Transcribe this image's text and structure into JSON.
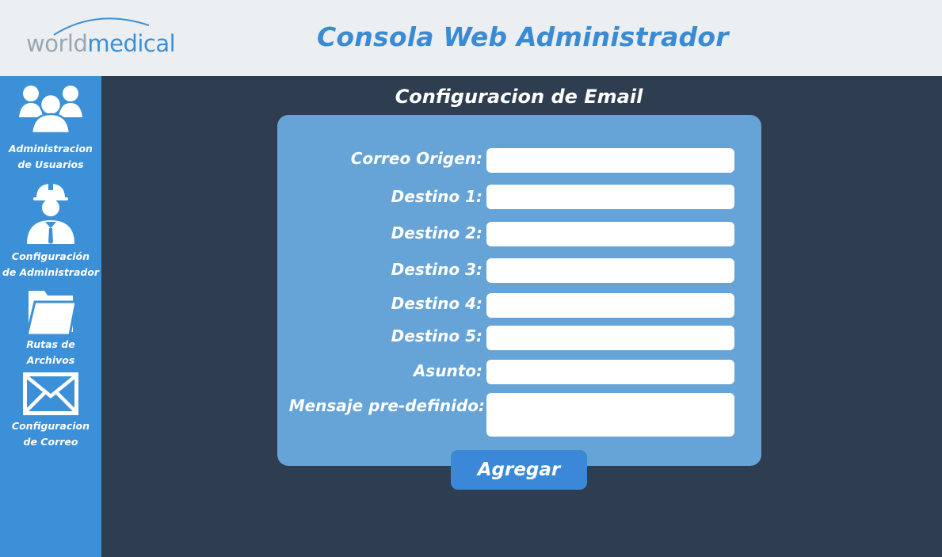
{
  "header": {
    "logo": {
      "part1": "world",
      "part2": "medical"
    },
    "title": "Consola Web Administrador"
  },
  "sidebar": {
    "items": [
      {
        "label": "Administracion\nde Usuarios",
        "icon": "users-icon"
      },
      {
        "label": "Configuración\nde Administrador",
        "icon": "administrator-icon"
      },
      {
        "label": "Rutas de\nArchivos",
        "icon": "folder-icon"
      },
      {
        "label": "Configuracion\nde Correo",
        "icon": "mail-icon"
      }
    ]
  },
  "main": {
    "heading": "Configuracion de Email",
    "fields": [
      {
        "label": "Correo Origen:",
        "value": ""
      },
      {
        "label": "Destino 1:",
        "value": ""
      },
      {
        "label": "Destino 2:",
        "value": ""
      },
      {
        "label": "Destino 3:",
        "value": ""
      },
      {
        "label": "Destino 4:",
        "value": ""
      },
      {
        "label": "Destino 5:",
        "value": ""
      },
      {
        "label": "Asunto:",
        "value": ""
      },
      {
        "label": "Mensaje pre-definido:",
        "value": ""
      }
    ],
    "submit_label": "Agregar"
  },
  "colors": {
    "header_bg": "#eceff1",
    "title": "#3a8ad4",
    "sidebar_bg": "#3b90d8",
    "main_bg": "#2e3d50",
    "panel_bg": "#66a3d6",
    "button_bg": "#3b88d8",
    "logo_gray": "#9aa7b1",
    "logo_blue": "#3a8fd6"
  }
}
